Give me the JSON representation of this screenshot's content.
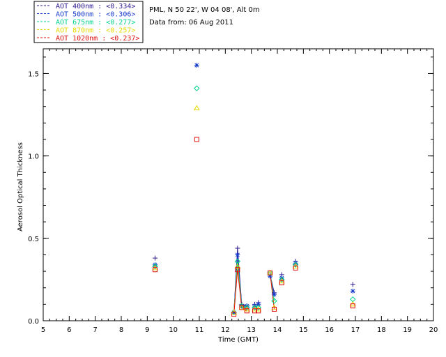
{
  "chart_data": {
    "type": "scatter",
    "title": "",
    "info_lines": [
      "PML, N 50 22', W 04 08', Alt 0m",
      "Data from: 06 Aug 2011"
    ],
    "xlabel": "Time (GMT)",
    "ylabel": "Aerosol Optical Thickness",
    "xlim": [
      5,
      20
    ],
    "ylim": [
      0,
      1.65
    ],
    "xticks": [
      5,
      6,
      7,
      8,
      9,
      10,
      11,
      12,
      13,
      14,
      15,
      16,
      17,
      18,
      19,
      20
    ],
    "yticks": [
      0.0,
      0.5,
      1.0,
      1.5
    ],
    "ytick_labels": [
      "0.0",
      "0.5",
      "1.0",
      "1.5"
    ],
    "grid": false,
    "legend_position": "top-left (outside plot)",
    "x": [
      9.3,
      10.9,
      12.33,
      12.47,
      12.63,
      12.83,
      13.13,
      13.27,
      13.72,
      13.88,
      14.17,
      14.7,
      16.9
    ],
    "lines_connected_segments": [
      [
        2,
        3,
        4,
        5
      ],
      [
        8,
        9
      ]
    ],
    "series": [
      {
        "name": "AOT  400nm : <0.334>",
        "color": "#2a1a8f",
        "marker": "plus",
        "values": [
          0.38,
          null,
          0.05,
          0.44,
          0.1,
          0.09,
          0.1,
          0.11,
          0.28,
          0.17,
          0.28,
          0.36,
          0.22
        ]
      },
      {
        "name": "AOT  500nm : <0.306>",
        "color": "#1a3ccc",
        "marker": "asterisk",
        "values": [
          0.34,
          1.55,
          0.05,
          0.4,
          0.09,
          0.09,
          0.09,
          0.1,
          0.27,
          0.16,
          0.26,
          0.35,
          0.18
        ]
      },
      {
        "name": "AOT  675nm : <0.277>",
        "color": "#00d48a",
        "marker": "diamond",
        "values": [
          0.33,
          1.41,
          0.05,
          0.36,
          0.09,
          0.08,
          0.08,
          0.08,
          0.29,
          0.12,
          0.25,
          0.34,
          0.13
        ]
      },
      {
        "name": "AOT  870nm : <0.257>",
        "color": "#e8d800",
        "marker": "triangle",
        "values": [
          0.32,
          1.29,
          0.05,
          0.33,
          0.08,
          0.07,
          0.07,
          0.07,
          0.29,
          0.08,
          0.24,
          0.33,
          0.1
        ]
      },
      {
        "name": "AOT 1020nm : <0.237>",
        "color": "#e01010",
        "marker": "square",
        "values": [
          0.31,
          1.1,
          0.04,
          0.31,
          0.08,
          0.06,
          0.06,
          0.06,
          0.29,
          0.07,
          0.23,
          0.32,
          0.09
        ]
      }
    ]
  }
}
